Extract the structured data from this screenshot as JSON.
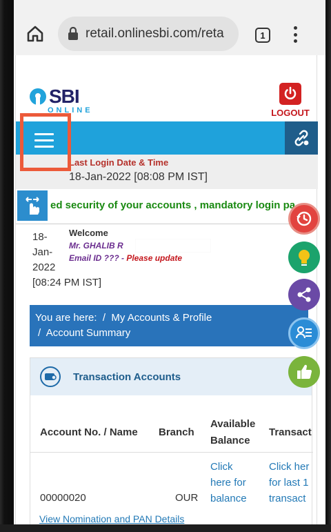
{
  "browser": {
    "url": "retail.onlinesbi.com/reta",
    "tab_count": "1",
    "icons": {
      "home": "home-icon",
      "lock": "lock-icon",
      "menu": "more-vert-icon"
    }
  },
  "header": {
    "logo_text": "SBI",
    "logo_subtext": "ONLINE",
    "logout_label": "LOGOUT"
  },
  "last_login": {
    "label": "Last Login Date & Time",
    "value": "18-Jan-2022 [08:08 PM IST]"
  },
  "ticker": {
    "text": "ed security of your accounts , mandatory login pa"
  },
  "welcome": {
    "date_lines": [
      "18-",
      "Jan-",
      "2022",
      "[08:24 PM IST]"
    ],
    "label": "Welcome",
    "name": "Mr. GHALIB R",
    "email_prefix": "Email ID ??? - ",
    "email_action": "Please update"
  },
  "breadcrumb": {
    "prefix": "You are here:",
    "sep": "/",
    "items": [
      "My Accounts & Profile",
      "Account Summary"
    ]
  },
  "accounts_card": {
    "title": "Transaction Accounts",
    "columns": [
      "Account No. / Name",
      "Branch",
      "Available Balance",
      "Transact"
    ],
    "col_lines": {
      "balance": [
        "Available",
        "Balance"
      ]
    },
    "row": {
      "account": "00000020",
      "branch": "OUR",
      "balance_lines": [
        "Click",
        "here for",
        "balance"
      ],
      "transact_lines": [
        "Click her",
        "for last 1",
        "transact"
      ]
    },
    "nomination_link": "View Nomination and PAN Details"
  },
  "floating_buttons": [
    "history-icon",
    "bulb-icon",
    "share-icon",
    "form-icon",
    "thumbs-up-icon"
  ],
  "colors": {
    "nav_blue": "#1fa2db",
    "breadcrumb_blue": "#2973ba",
    "highlight_orange": "#ec5a3a",
    "logout_red": "#c4161c",
    "ticker_green": "#1a8a12"
  }
}
